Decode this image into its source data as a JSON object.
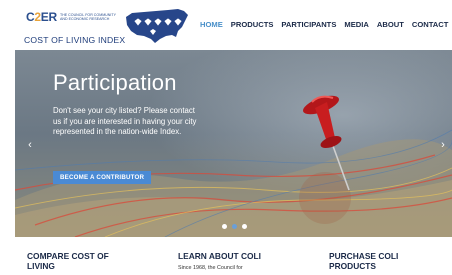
{
  "logo": {
    "brand_prefix": "C",
    "brand_number": "2",
    "brand_suffix": "ER",
    "tagline": "THE COUNCIL FOR COMMUNITY AND ECONOMIC RESEARCH",
    "title": "COST OF LIVING INDEX"
  },
  "nav": {
    "items": [
      {
        "label": "HOME",
        "active": true
      },
      {
        "label": "PRODUCTS"
      },
      {
        "label": "PARTICIPANTS"
      },
      {
        "label": "MEDIA"
      },
      {
        "label": "ABOUT"
      },
      {
        "label": "CONTACT"
      }
    ]
  },
  "hero": {
    "title": "Participation",
    "body": "Don't see your city listed? Please contact us if you are interested in having your city represented in the nation-wide Index.",
    "button": "BECOME A CONTRIBUTOR",
    "prev_icon": "chevron-left-icon",
    "next_icon": "chevron-right-icon",
    "slide_count": 3,
    "active_slide": 2
  },
  "columns": [
    {
      "heading": "COMPARE COST OF LIVING",
      "text": ""
    },
    {
      "heading": "LEARN ABOUT COLI",
      "text": "Since 1968, the Council for"
    },
    {
      "heading": "PURCHASE COLI PRODUCTS",
      "text": ""
    }
  ],
  "colors": {
    "brand_blue": "#2b4f8e",
    "accent": "#4a90c9",
    "button": "#4a8ad4",
    "pin_red": "#d81e1e"
  }
}
